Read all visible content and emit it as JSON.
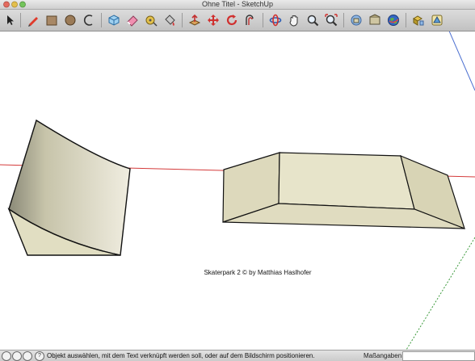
{
  "window": {
    "title": "Ohne Titel - SketchUp"
  },
  "toolbar": {
    "tools": [
      {
        "name": "select-tool-button",
        "icon": "arrow-icon"
      },
      {
        "name": "line-tool-button",
        "icon": "pencil-icon"
      },
      {
        "name": "rectangle-tool-button",
        "icon": "rectangle-icon"
      },
      {
        "name": "circle-tool-button",
        "icon": "circle-icon"
      },
      {
        "name": "arc-tool-button",
        "icon": "arc-icon"
      },
      {
        "name": "make-component-button",
        "icon": "component-icon"
      },
      {
        "name": "eraser-tool-button",
        "icon": "eraser-icon"
      },
      {
        "name": "tape-measure-button",
        "icon": "tape-icon"
      },
      {
        "name": "paint-bucket-button",
        "icon": "bucket-icon"
      },
      {
        "name": "push-pull-button",
        "icon": "pushpull-icon"
      },
      {
        "name": "move-tool-button",
        "icon": "move-icon"
      },
      {
        "name": "rotate-tool-button",
        "icon": "rotate-icon"
      },
      {
        "name": "offset-tool-button",
        "icon": "offset-icon"
      },
      {
        "name": "orbit-tool-button",
        "icon": "orbit-icon"
      },
      {
        "name": "pan-tool-button",
        "icon": "hand-icon"
      },
      {
        "name": "zoom-tool-button",
        "icon": "zoom-icon"
      },
      {
        "name": "zoom-extents-button",
        "icon": "zoom-extents-icon"
      },
      {
        "name": "get-models-button",
        "icon": "get-models-icon"
      },
      {
        "name": "share-model-button",
        "icon": "share-model-icon"
      },
      {
        "name": "google-earth-button",
        "icon": "earth-icon"
      },
      {
        "name": "components-button",
        "icon": "components-icon"
      },
      {
        "name": "styles-button",
        "icon": "styles-icon"
      }
    ]
  },
  "viewport": {
    "watermark": "Skaterpark 2 © by Matthias Haslhofer"
  },
  "statusbar": {
    "text": "Objekt auswählen, mit dem Text verknüpft werden soll, oder auf dem Bildschirm positionieren.",
    "measure_label": "Maßangaben",
    "measure_value": "",
    "help_icon_glyph": "?"
  },
  "colors": {
    "face": "#e2dfc4",
    "red_axis": "#d43a3a",
    "blue_axis": "#4b6fd0",
    "green_axis": "#3b9a3b"
  }
}
